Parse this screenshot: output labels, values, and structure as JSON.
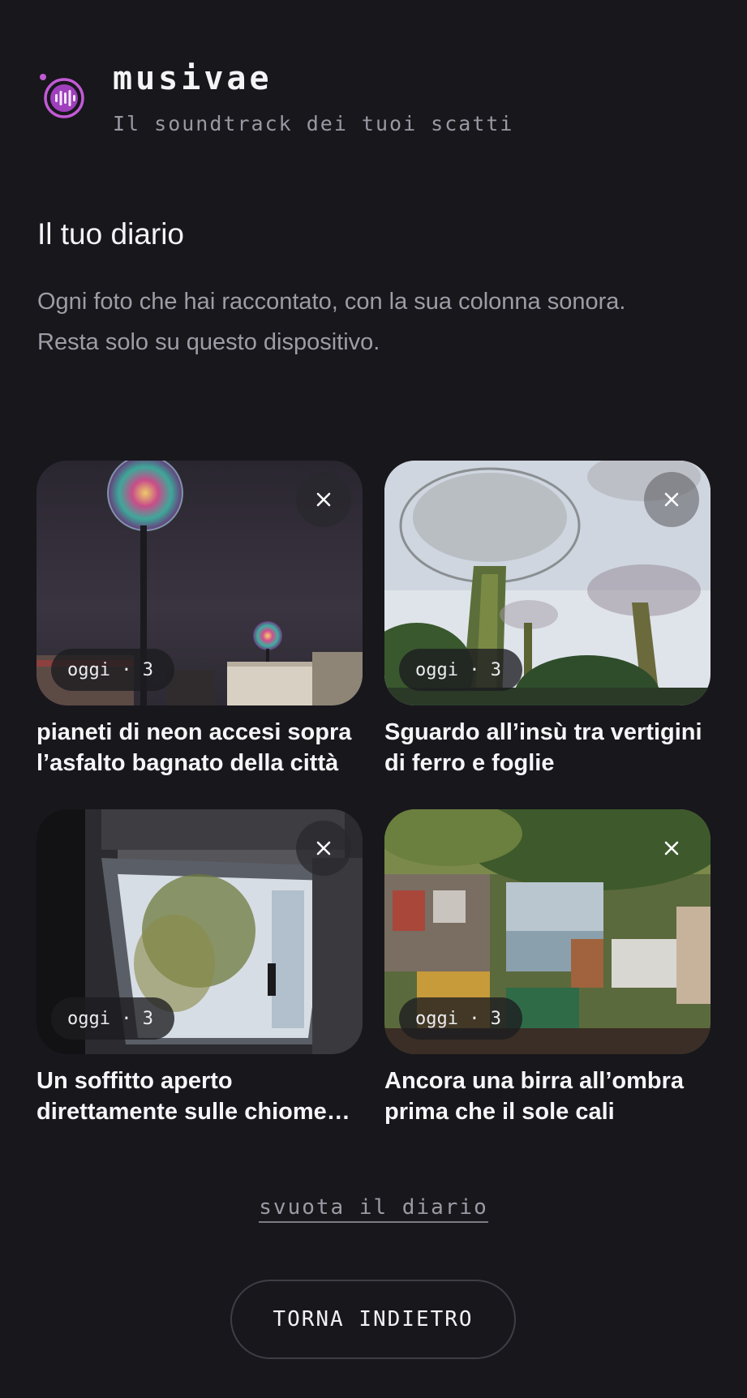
{
  "app": {
    "name": "musivae",
    "tagline": "Il soundtrack dei tuoi scatti",
    "accent": "#c25ad6"
  },
  "diary": {
    "title": "Il tuo diario",
    "description": "Ogni foto che hai raccontato, con la sua colonna sonora. Resta solo su questo dispositivo."
  },
  "entries": [
    {
      "when": "oggi",
      "count": "3",
      "meta": "oggi · 3",
      "title": "pianeti di neon accesi sopra l’asfalto bagnato della città",
      "remove_icon": "close-icon"
    },
    {
      "when": "oggi",
      "count": "3",
      "meta": "oggi · 3",
      "title": "Sguardo all’insù tra vertigini di ferro e foglie",
      "remove_icon": "close-icon"
    },
    {
      "when": "oggi",
      "count": "3",
      "meta": "oggi · 3",
      "title": "Un soffitto aperto direttamente sulle chiome degli alberi",
      "remove_icon": "close-icon"
    },
    {
      "when": "oggi",
      "count": "3",
      "meta": "oggi · 3",
      "title": "Ancora una birra all’ombra prima che il sole cali",
      "remove_icon": "close-icon"
    }
  ],
  "actions": {
    "clear_diary": "svuota il diario",
    "back": "TORNA INDIETRO"
  }
}
